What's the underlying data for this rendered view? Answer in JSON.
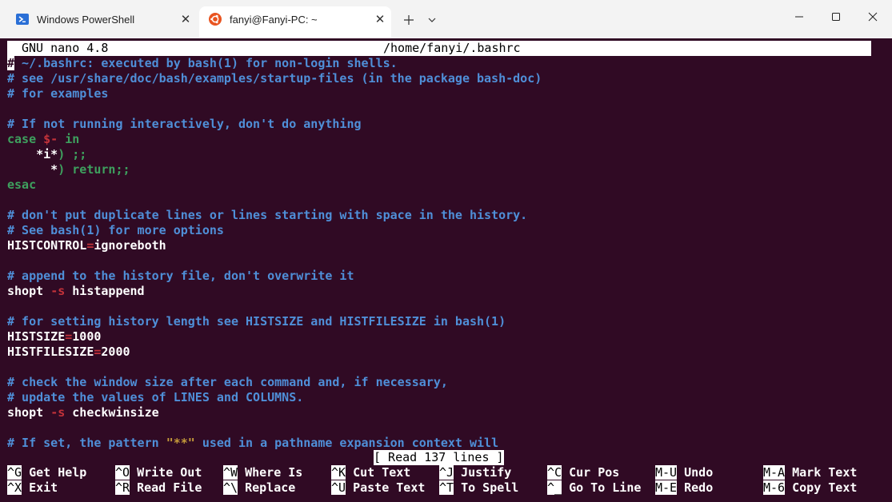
{
  "tabs": [
    {
      "title": "Windows PowerShell",
      "icon": "powershell-icon"
    },
    {
      "title": "fanyi@Fanyi-PC: ~",
      "icon": "ubuntu-icon"
    }
  ],
  "tab_bar": {
    "new_tab_label": "+",
    "dropdown_label": "⌄"
  },
  "window_controls": {
    "minimize": "—",
    "maximize": "☐",
    "close": "✕"
  },
  "colors": {
    "terminal_bg": "#300a24",
    "comment": "#4f8fd8",
    "keyword": "#3ea05e",
    "operator": "#c3323a",
    "string": "#c49a3a"
  },
  "nano": {
    "version": "GNU nano 4.8",
    "file_path": "/home/fanyi/.bashrc",
    "status_message": "[ Read 137 lines ]",
    "lines": [
      [
        {
          "t": "#",
          "k": "cursor"
        },
        {
          "t": " ~/.bashrc: executed by bash(1) for non-login shells.",
          "k": "c"
        }
      ],
      [
        {
          "t": "# see /usr/share/doc/bash/examples/startup-files (in the package bash-doc)",
          "k": "c"
        }
      ],
      [
        {
          "t": "# for examples",
          "k": "c"
        }
      ],
      [],
      [
        {
          "t": "# If not running interactively, don't do anything",
          "k": "c"
        }
      ],
      [
        {
          "t": "case ",
          "k": "k"
        },
        {
          "t": "$-",
          "k": "r"
        },
        {
          "t": " in",
          "k": "k"
        }
      ],
      [
        {
          "t": "    *i*",
          "k": "w"
        },
        {
          "t": ") ;;",
          "k": "k"
        }
      ],
      [
        {
          "t": "      *",
          "k": "w"
        },
        {
          "t": ") return;;",
          "k": "k"
        }
      ],
      [
        {
          "t": "esac",
          "k": "k"
        }
      ],
      [],
      [
        {
          "t": "# don't put duplicate lines or lines starting with space in the history.",
          "k": "c"
        }
      ],
      [
        {
          "t": "# See bash(1) for more options",
          "k": "c"
        }
      ],
      [
        {
          "t": "HISTCONTROL",
          "k": "w"
        },
        {
          "t": "=",
          "k": "r"
        },
        {
          "t": "ignoreboth",
          "k": "w"
        }
      ],
      [],
      [
        {
          "t": "# append to the history file, don't overwrite it",
          "k": "c"
        }
      ],
      [
        {
          "t": "shopt ",
          "k": "w"
        },
        {
          "t": "-s",
          "k": "r"
        },
        {
          "t": " histappend",
          "k": "w"
        }
      ],
      [],
      [
        {
          "t": "# for setting history length see HISTSIZE and HISTFILESIZE in bash(1)",
          "k": "c"
        }
      ],
      [
        {
          "t": "HISTSIZE",
          "k": "w"
        },
        {
          "t": "=",
          "k": "r"
        },
        {
          "t": "1000",
          "k": "w"
        }
      ],
      [
        {
          "t": "HISTFILESIZE",
          "k": "w"
        },
        {
          "t": "=",
          "k": "r"
        },
        {
          "t": "2000",
          "k": "w"
        }
      ],
      [],
      [
        {
          "t": "# check the window size after each command and, if necessary,",
          "k": "c"
        }
      ],
      [
        {
          "t": "# update the values of LINES and COLUMNS.",
          "k": "c"
        }
      ],
      [
        {
          "t": "shopt ",
          "k": "w"
        },
        {
          "t": "-s",
          "k": "r"
        },
        {
          "t": " checkwinsize",
          "k": "w"
        }
      ],
      [],
      [
        {
          "t": "# If set, the pattern ",
          "k": "c"
        },
        {
          "t": "\"**\"",
          "k": "s"
        },
        {
          "t": " used in a pathname expansion context will",
          "k": "c"
        }
      ]
    ],
    "shortcuts": [
      [
        {
          "key": "^G",
          "label": "Get Help"
        },
        {
          "key": "^O",
          "label": "Write Out"
        },
        {
          "key": "^W",
          "label": "Where Is"
        },
        {
          "key": "^K",
          "label": "Cut Text"
        },
        {
          "key": "^J",
          "label": "Justify"
        },
        {
          "key": "^C",
          "label": "Cur Pos"
        },
        {
          "key": "M-U",
          "label": "Undo"
        },
        {
          "key": "M-A",
          "label": "Mark Text"
        }
      ],
      [
        {
          "key": "^X",
          "label": "Exit"
        },
        {
          "key": "^R",
          "label": "Read File"
        },
        {
          "key": "^\\",
          "label": "Replace"
        },
        {
          "key": "^U",
          "label": "Paste Text"
        },
        {
          "key": "^T",
          "label": "To Spell"
        },
        {
          "key": "^_",
          "label": "Go To Line"
        },
        {
          "key": "M-E",
          "label": "Redo"
        },
        {
          "key": "M-6",
          "label": "Copy Text"
        }
      ]
    ]
  }
}
